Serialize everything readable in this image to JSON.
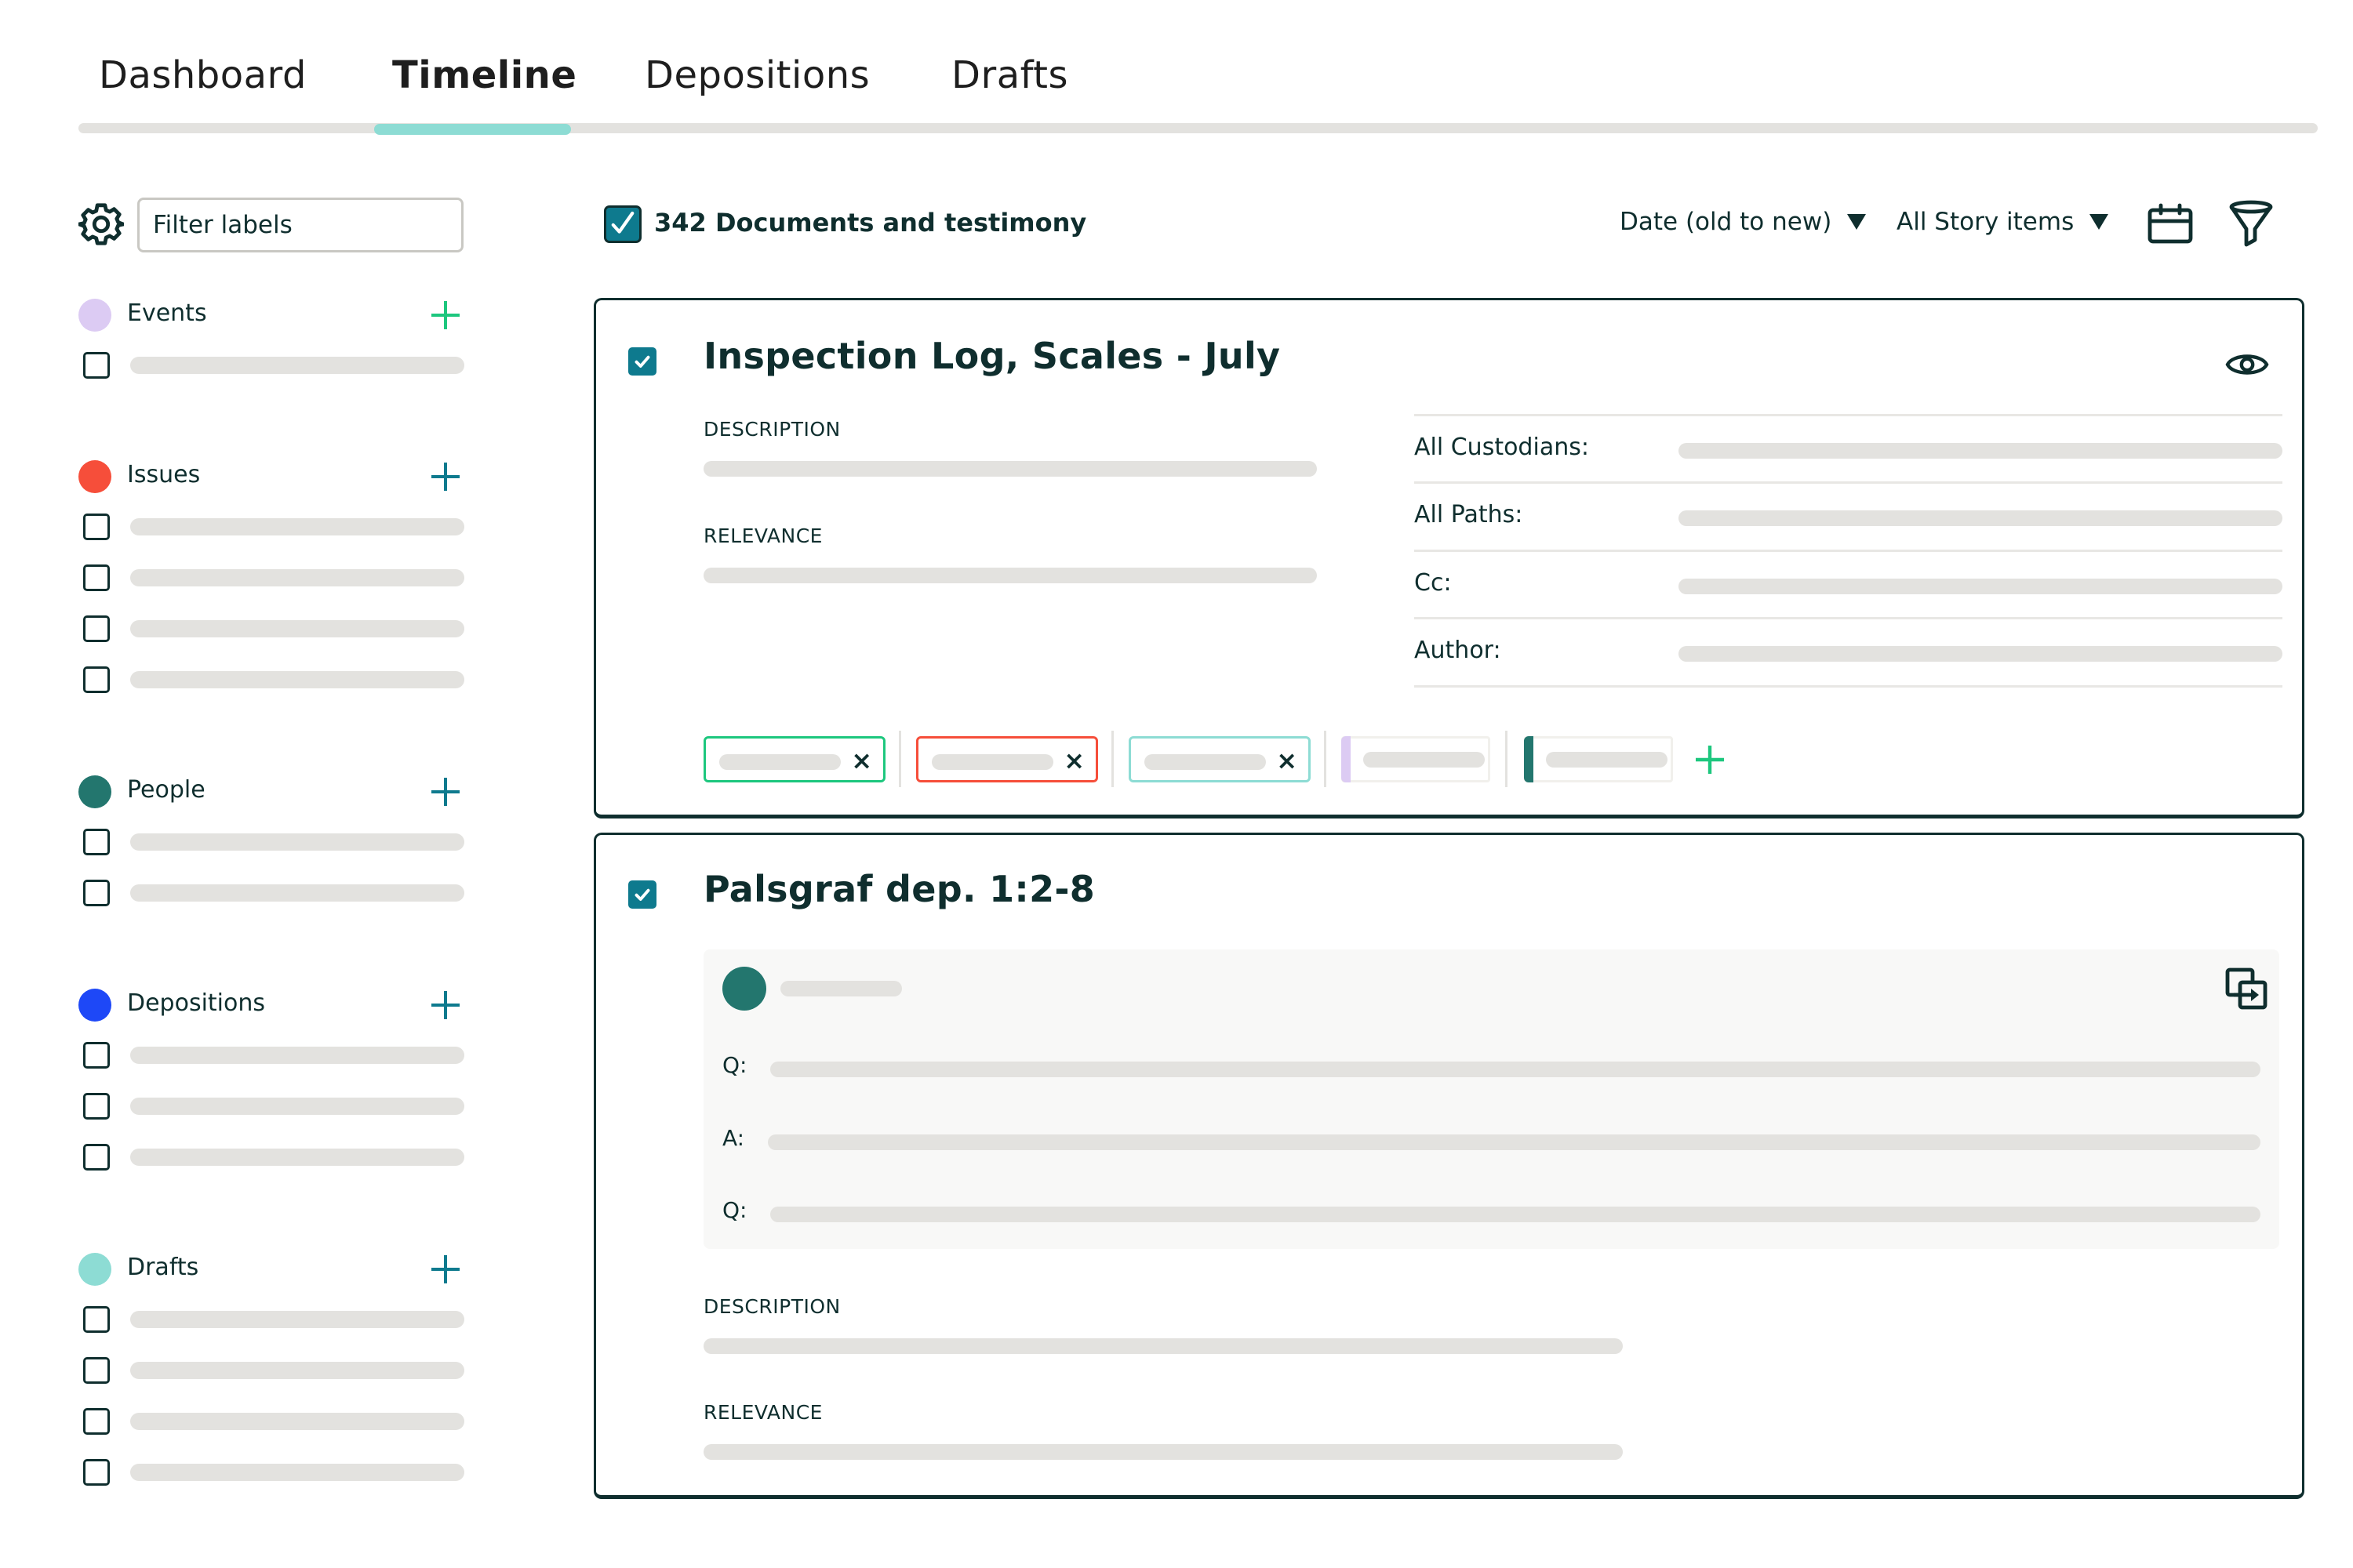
{
  "tabs": [
    {
      "label": "Dashboard",
      "active": false
    },
    {
      "label": "Timeline",
      "active": true
    },
    {
      "label": "Depositions",
      "active": false
    },
    {
      "label": "Drafts",
      "active": false
    }
  ],
  "colors": {
    "accent_teal": "#8ddcd4",
    "checkbox_blue": "#0e7a8e",
    "text_dark": "#0f2e2e",
    "placeholder_gray": "#e3e2df",
    "add_green": "#1dc77e"
  },
  "sidebar": {
    "settings_icon": "gear-icon",
    "filter": {
      "placeholder": "Filter labels",
      "value": ""
    },
    "groups": [
      {
        "label": "Events",
        "color": "#dccbf3",
        "add_icon_color": "#1dc77e",
        "item_count": 1
      },
      {
        "label": "Issues",
        "color": "#f64e3a",
        "add_icon_color": "#0e7a8e",
        "item_count": 4
      },
      {
        "label": "People",
        "color": "#23766e",
        "add_icon_color": "#0e7a8e",
        "item_count": 2
      },
      {
        "label": "Depositions",
        "color": "#1e48f7",
        "add_icon_color": "#0e7a8e",
        "item_count": 3
      },
      {
        "label": "Drafts",
        "color": "#8ddcd4",
        "add_icon_color": "#0e7a8e",
        "item_count": 4
      }
    ]
  },
  "toolbar": {
    "select_all_checked": true,
    "count_label": "342 Documents and testimony",
    "sort": {
      "selected": "Date (old to new)"
    },
    "filter_type": {
      "selected": "All Story items"
    },
    "icons": [
      "calendar-icon",
      "funnel-icon"
    ]
  },
  "cards": [
    {
      "title": "Inspection Log, Scales - July",
      "checked": true,
      "description_label": "DESCRIPTION",
      "relevance_label": "RELEVANCE",
      "metadata": [
        {
          "label": "All Custodians:"
        },
        {
          "label": "All Paths:"
        },
        {
          "label": "Cc:"
        },
        {
          "label": "Author:"
        }
      ],
      "tags": [
        {
          "color": "#1dc77e",
          "removable": true
        },
        {
          "color": "#f64e3a",
          "removable": true
        },
        {
          "color": "#8ddcd4",
          "removable": true
        },
        {
          "color": "#dccbf3",
          "removable": false
        },
        {
          "color": "#23766e",
          "removable": false
        }
      ],
      "remove_glyph": "×",
      "add_tag_icon": "plus-icon"
    },
    {
      "title": "Palsgraf dep. 1:2-8",
      "checked": true,
      "transcript": {
        "lines": [
          {
            "label": "Q:"
          },
          {
            "label": "A:"
          },
          {
            "label": "Q:"
          }
        ]
      },
      "description_label": "DESCRIPTION",
      "relevance_label": "RELEVANCE"
    }
  ]
}
